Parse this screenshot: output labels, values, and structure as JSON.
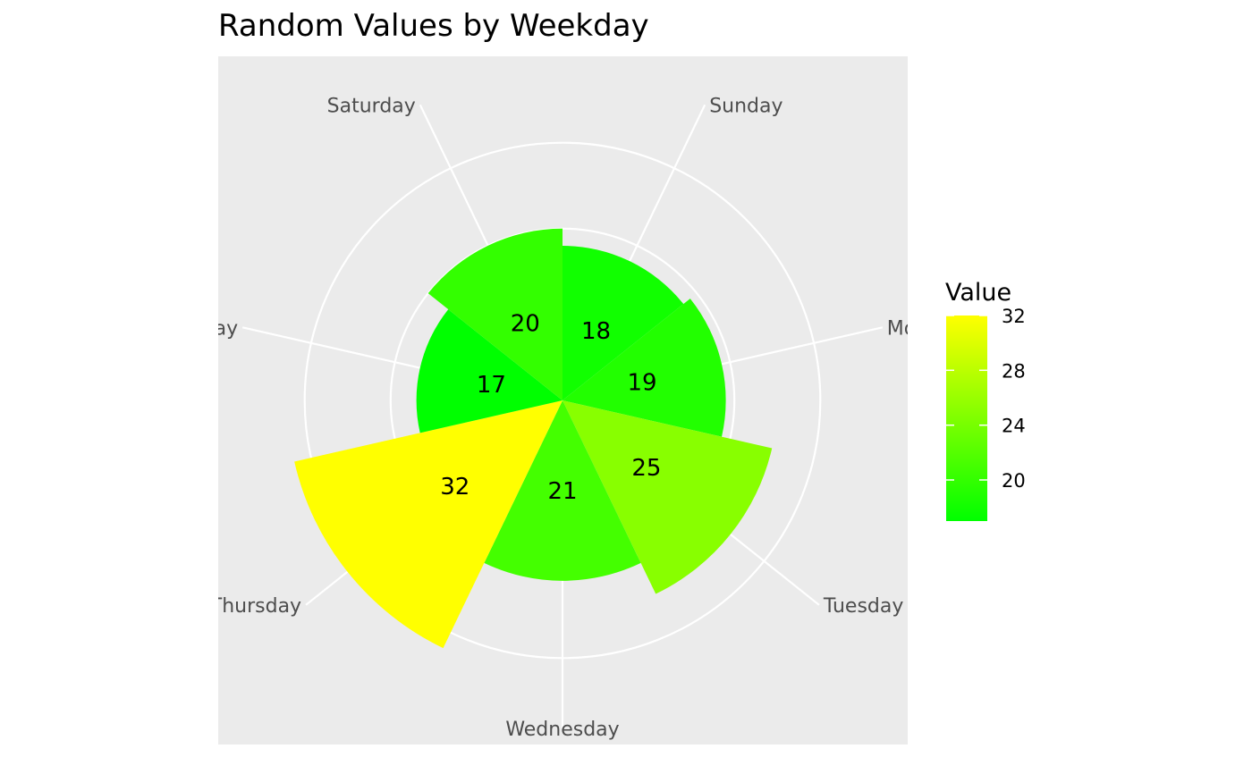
{
  "chart_data": {
    "type": "bar",
    "coord": "polar",
    "title": "Random Values by Weekday",
    "categories": [
      "Sunday",
      "Monday",
      "Tuesday",
      "Wednesday",
      "Thursday",
      "Friday",
      "Saturday"
    ],
    "values": [
      18,
      19,
      25,
      21,
      32,
      17,
      20
    ],
    "rlim": [
      0,
      36
    ],
    "r_gridlines": [
      10,
      20,
      30
    ],
    "grid": true,
    "panel_background": "#EBEBEB",
    "gridline_color": "#FFFFFF",
    "fill_scale": {
      "low_color": "#00FF00",
      "high_color": "#FFFF00",
      "range": [
        17,
        32
      ]
    },
    "legend": {
      "title": "Value",
      "position": "right",
      "ticks": [
        32,
        28,
        24,
        20
      ]
    }
  }
}
